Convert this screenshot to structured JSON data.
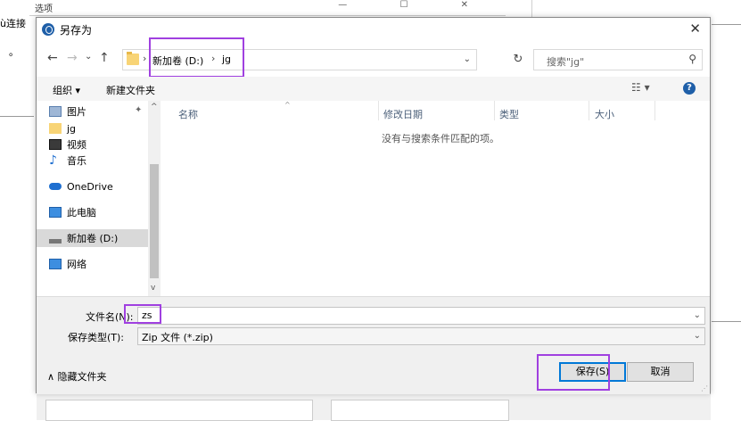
{
  "background": {
    "title": "选项",
    "left_text": "ù连接",
    "dot": "。"
  },
  "dialog": {
    "title": "另存为",
    "close": "✕"
  },
  "nav": {
    "back": "←",
    "forward": "→",
    "recent": "⌄",
    "up": "↑",
    "breadcrumb": [
      "新加卷 (D:)",
      "jg"
    ],
    "refresh": "↻",
    "search_placeholder": "搜索\"jg\"",
    "search_icon": "⚲"
  },
  "toolbar": {
    "organize": "组织 ▾",
    "new_folder": "新建文件夹",
    "view": "☷ ▾",
    "help": "?"
  },
  "sidebar": {
    "items": [
      {
        "label": "图片",
        "icon": "pictures-icon"
      },
      {
        "label": "jg",
        "icon": "folder-icon"
      },
      {
        "label": "视频",
        "icon": "video-icon"
      },
      {
        "label": "音乐",
        "icon": "music-icon"
      },
      {
        "label": "OneDrive",
        "icon": "cloud-icon"
      },
      {
        "label": "此电脑",
        "icon": "computer-icon"
      },
      {
        "label": "新加卷 (D:)",
        "icon": "drive-icon"
      },
      {
        "label": "网络",
        "icon": "network-icon"
      }
    ],
    "selected_index": 6
  },
  "columns": [
    "名称",
    "修改日期",
    "类型",
    "大小"
  ],
  "empty_message": "没有与搜索条件匹配的项。",
  "form": {
    "filename_label": "文件名(N):",
    "filename_value": "zs",
    "filetype_label": "保存类型(T):",
    "filetype_value": "Zip 文件 (*.zip)",
    "hide_folders": "∧  隐藏文件夹",
    "save": "保存(S)",
    "cancel": "取消"
  },
  "colors": {
    "highlight": "#a040e0",
    "accent": "#0078d7"
  }
}
